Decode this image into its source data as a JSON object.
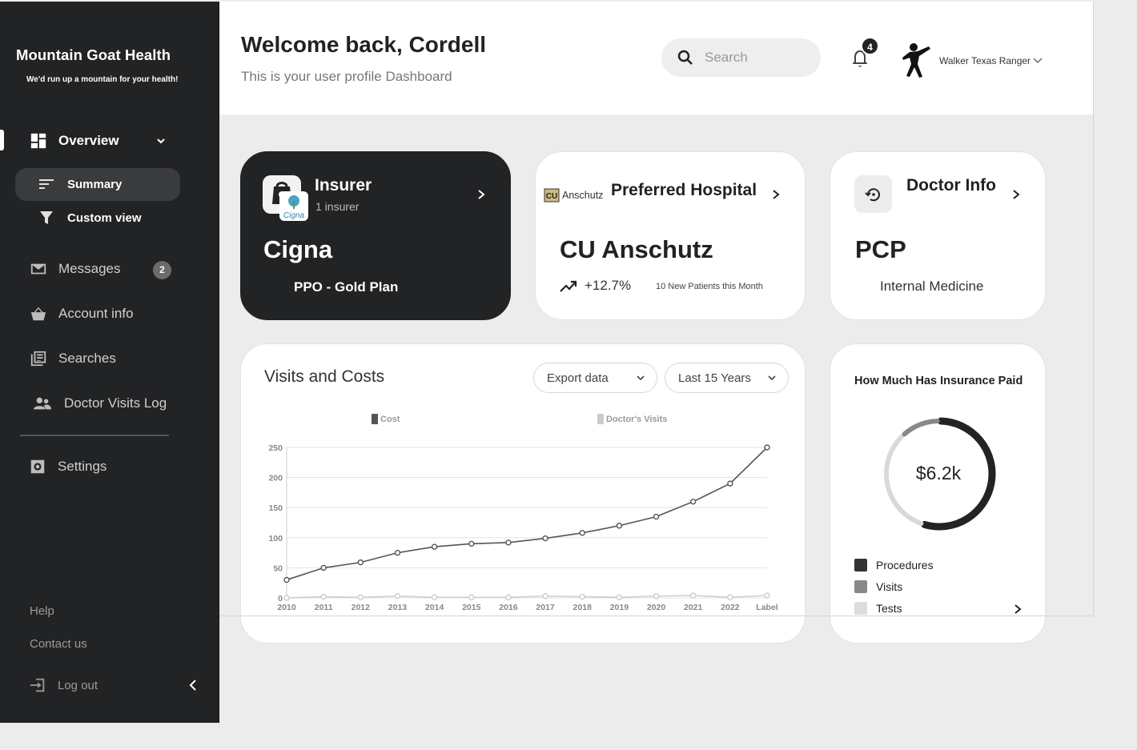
{
  "brand": {
    "name": "Mountain Goat Health",
    "tagline": "We'd run up a mountain for your health!"
  },
  "sidebar": {
    "overview": "Overview",
    "sub_items": [
      {
        "label": "Summary",
        "icon": "sort-lines-icon"
      },
      {
        "label": "Custom view",
        "icon": "filter-icon"
      }
    ],
    "items": [
      {
        "label": "Messages",
        "icon": "mail-icon",
        "badge": "2"
      },
      {
        "label": "Account info",
        "icon": "basket-icon"
      },
      {
        "label": "Searches",
        "icon": "library-icon"
      },
      {
        "label": "Doctor Visits Log",
        "icon": "people-icon"
      },
      {
        "label": "Settings",
        "icon": "gear-icon"
      }
    ],
    "footer": {
      "help": "Help",
      "contact": "Contact us",
      "logout": "Log out"
    }
  },
  "header": {
    "welcome": "Welcome back, Cordell",
    "subtitle": "This is your user profile Dashboard",
    "search_placeholder": "Search",
    "notifications": "4",
    "user_name": "Walker Texas Ranger"
  },
  "cards": {
    "insurer": {
      "title": "Insurer",
      "subtitle": "1 insurer",
      "name": "Cigna",
      "plan": "PPO - Gold Plan",
      "logo_text": "Cigna"
    },
    "hospital": {
      "logo_text": "Anschutz",
      "title": "Preferred Hospital",
      "name": "CU Anschutz",
      "change": "+12.7%",
      "note": "10 New Patients this Month"
    },
    "doctor": {
      "title": "Doctor Info",
      "name": "PCP",
      "specialty": "Internal Medicine"
    }
  },
  "visits_card": {
    "title": "Visits and Costs",
    "export_label": "Export data",
    "range_label": "Last 15 Years"
  },
  "chart_data": {
    "type": "line",
    "title": "Visits and Costs",
    "categories": [
      "2010",
      "2011",
      "2012",
      "2013",
      "2014",
      "2015",
      "2016",
      "2017",
      "2018",
      "2019",
      "2020",
      "2021",
      "2022",
      "Label"
    ],
    "series": [
      {
        "name": "Cost",
        "color": "#555555",
        "values": [
          30,
          50,
          59,
          75,
          85,
          90,
          92,
          99,
          108,
          120,
          135,
          160,
          190,
          250
        ]
      },
      {
        "name": "Doctor's Visits",
        "color": "#cccccc",
        "values": [
          0,
          2,
          1,
          3,
          1,
          1,
          1,
          3,
          2,
          1,
          3,
          4,
          1,
          4
        ]
      }
    ],
    "yticks": [
      0,
      50,
      100,
      150,
      200,
      250
    ],
    "ylim": [
      0,
      250
    ],
    "grid": true,
    "legend_position": "top"
  },
  "insurance_card": {
    "title": "How Much Has Insurance Paid",
    "total": "$6.2k",
    "legend": [
      {
        "label": "Procedures",
        "color": "#222325"
      },
      {
        "label": "Visits",
        "color": "#888888"
      },
      {
        "label": "Tests",
        "color": "#d9d9d9"
      }
    ]
  },
  "donut_data": {
    "type": "pie",
    "segments": [
      {
        "label": "Procedures",
        "value": 55,
        "color": "#222325"
      },
      {
        "label": "Tests",
        "value": 33,
        "color": "#d9d9d9"
      },
      {
        "label": "Visits",
        "value": 12,
        "color": "#888888"
      }
    ]
  }
}
